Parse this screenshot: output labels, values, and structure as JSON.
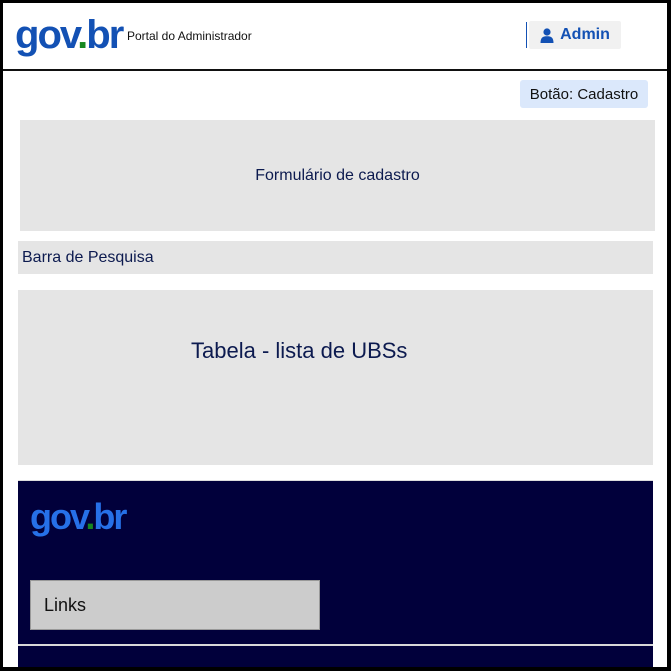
{
  "header": {
    "logo": {
      "g": "g",
      "o1": "o",
      "v": "v",
      "dot": ".",
      "b": "b",
      "r": "r"
    },
    "portal_title": "Portal do Administrador",
    "admin_label": "Admin",
    "admin_icon": "user-icon"
  },
  "main": {
    "cadastro_button": "Botão: Cadastro",
    "form_placeholder": "Formulário de cadastro",
    "search_placeholder": "Barra de Pesquisa",
    "table_placeholder": "Tabela - lista de UBSs"
  },
  "footer": {
    "logo": {
      "g": "g",
      "o1": "o",
      "v": "v",
      "dot": ".",
      "b": "b",
      "r": "r"
    },
    "links_label": "Links"
  },
  "colors": {
    "brand_blue": "#1351b4",
    "brand_yellow": "#ffcd07",
    "brand_green": "#168821",
    "footer_bg": "#01003b",
    "placeholder_bg": "#e5e5e5"
  }
}
